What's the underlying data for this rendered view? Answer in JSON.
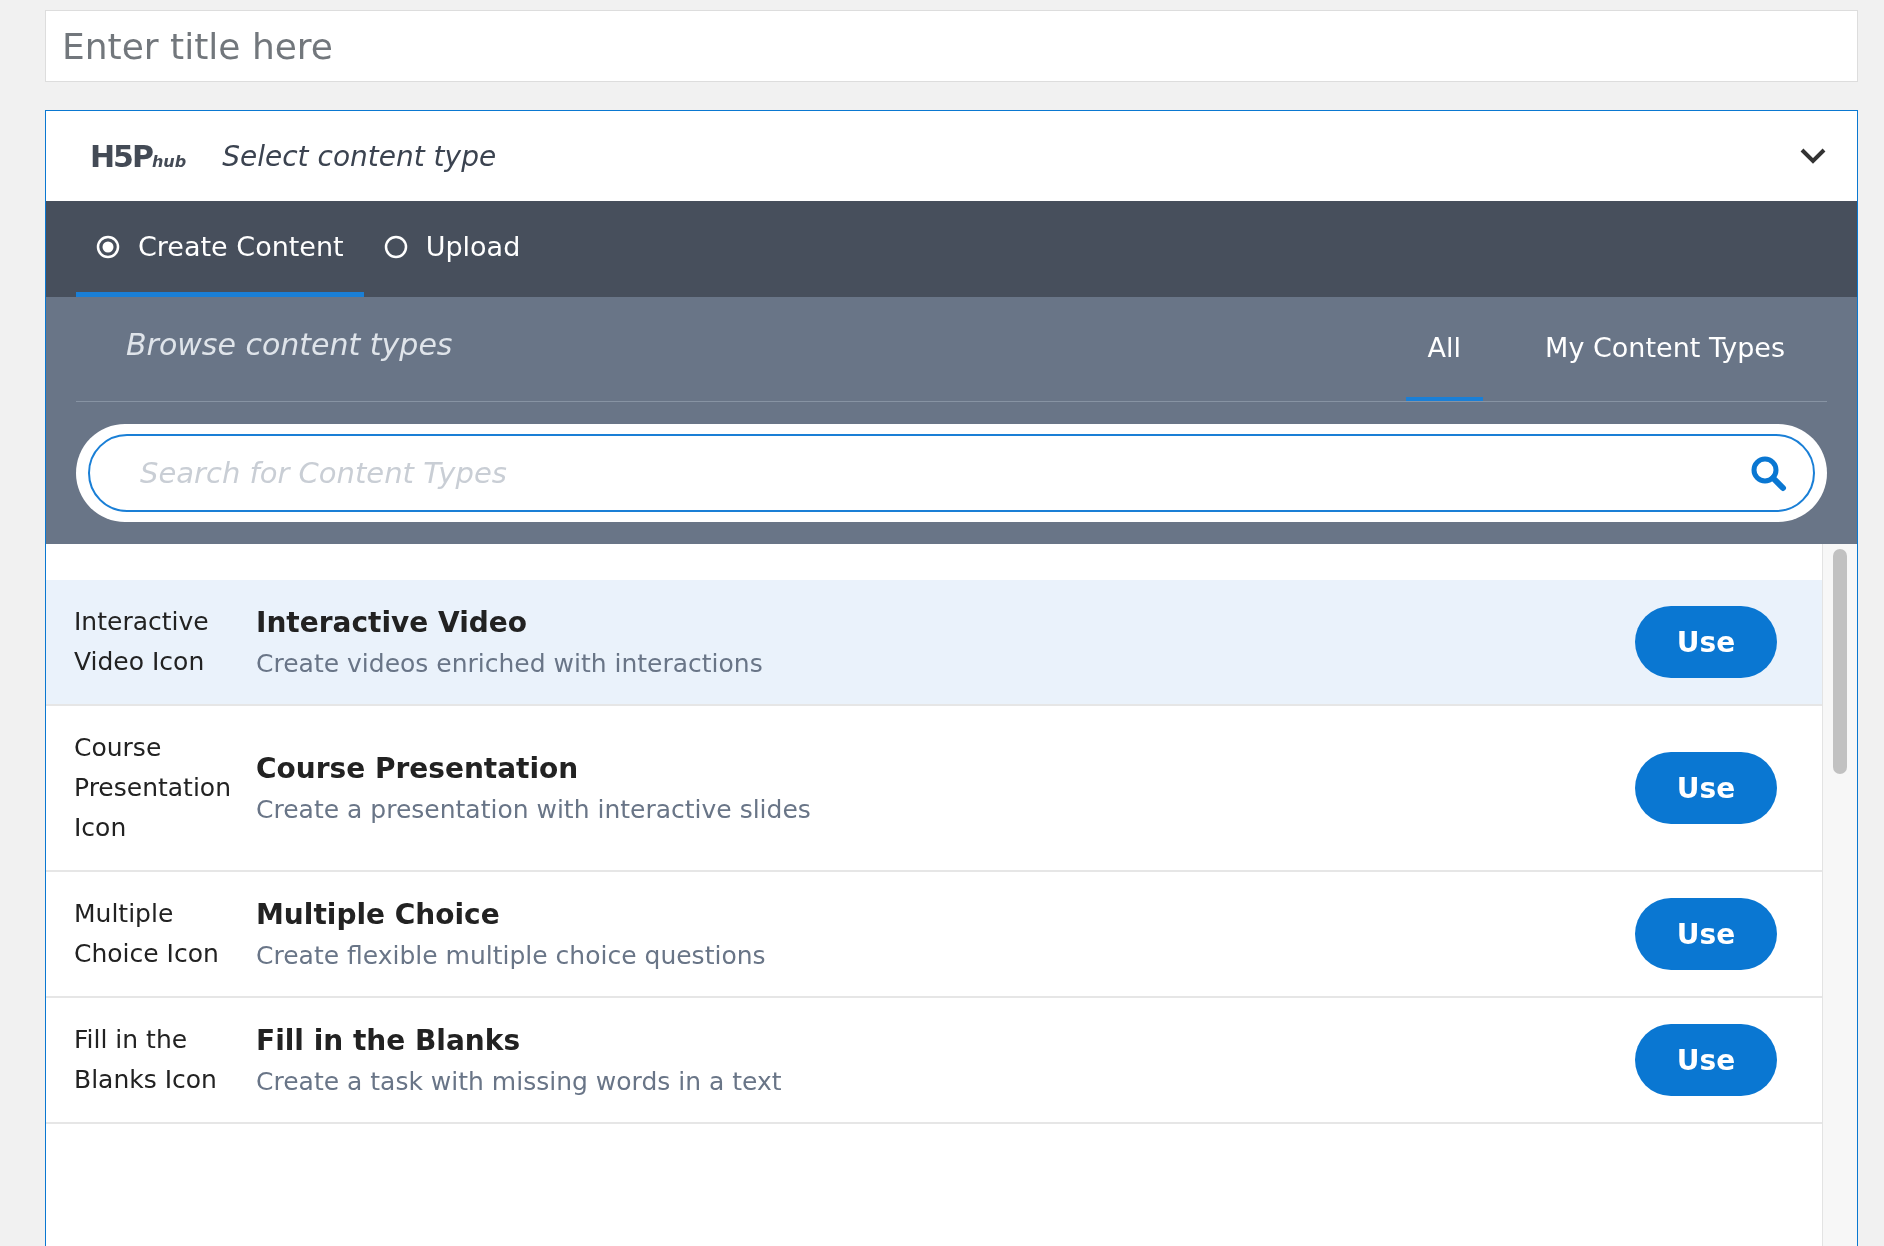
{
  "title_field": {
    "placeholder": "Enter title here"
  },
  "hub": {
    "logo": {
      "main": "H5P",
      "sub": "hub"
    },
    "title": "Select content type",
    "expanded": true
  },
  "modes": [
    {
      "label": "Create Content",
      "selected": true
    },
    {
      "label": "Upload",
      "selected": false
    }
  ],
  "browse": {
    "heading": "Browse content types",
    "filters": [
      {
        "label": "All",
        "selected": true
      },
      {
        "label": "My Content Types",
        "selected": false
      }
    ],
    "search": {
      "placeholder": "Search for Content Types"
    }
  },
  "content_types": [
    {
      "icon_alt": "Interactive Video Icon",
      "title": "Interactive Video",
      "description": "Create videos enriched with interactions",
      "button": "Use",
      "selected": true
    },
    {
      "icon_alt": "Course Presentation Icon",
      "title": "Course Presentation",
      "description": "Create a presentation with interactive slides",
      "button": "Use",
      "selected": false
    },
    {
      "icon_alt": "Multiple Choice Icon",
      "title": "Multiple Choice",
      "description": "Create flexible multiple choice questions",
      "button": "Use",
      "selected": false
    },
    {
      "icon_alt": "Fill in the Blanks Icon",
      "title": "Fill in the Blanks",
      "description": "Create a task with missing words in a text",
      "button": "Use",
      "selected": false
    }
  ]
}
